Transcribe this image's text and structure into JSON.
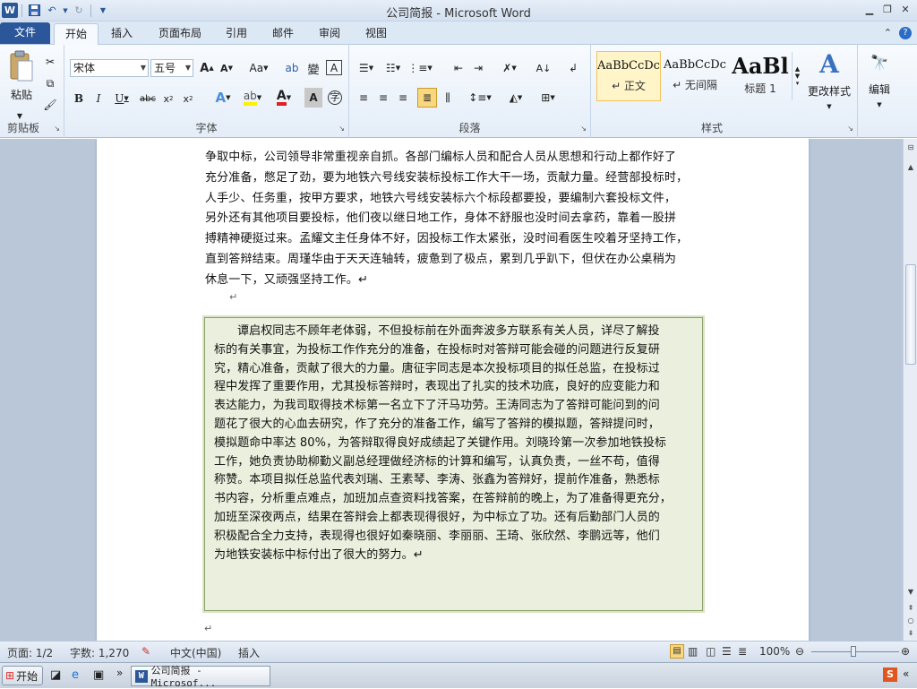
{
  "app": {
    "title": "公司简报 - Microsoft Word"
  },
  "tabs": [
    "文件",
    "开始",
    "插入",
    "页面布局",
    "引用",
    "邮件",
    "审阅",
    "视图"
  ],
  "ribbon": {
    "clipboard": {
      "paste": "粘贴",
      "label": "剪贴板"
    },
    "font": {
      "name": "宋体",
      "size": "五号",
      "label": "字体"
    },
    "paragraph": {
      "label": "段落"
    },
    "styles": {
      "label": "样式",
      "items": [
        {
          "sample": "AaBbCcDc",
          "name": "↵ 正文"
        },
        {
          "sample": "AaBbCcDc",
          "name": "↵ 无间隔"
        },
        {
          "sample": "AaBl",
          "name": "标题 1"
        }
      ],
      "change_styles": "更改样式"
    },
    "editing": {
      "label": "编辑"
    }
  },
  "document": {
    "para1_lines": [
      "争取中标，公司领导非常重视亲自抓。各部门编标人员和配合人员从思想和行动上都作好了",
      "充分准备，憋足了劲，要为地铁六号线安装标投标工作大干一场，贡献力量。经营部投标时，",
      "人手少、任务重，按甲方要求，地铁六号线安装标六个标段都要投，要编制六套投标文件，",
      "另外还有其他项目要投标，他们夜以继日地工作，身体不舒服也没时间去拿药，靠着一股拼",
      "搏精神硬挺过来。孟耀文主任身体不好，因投标工作太紧张，没时间看医生咬着牙坚持工作，",
      "直到答辩结束。周瑾华由于天天连轴转，疲惫到了极点，累到几乎趴下，但伏在办公桌稍为",
      "休息一下，又顽强坚持工作。↵"
    ],
    "empty_para_mark": "↵",
    "textbox_lines": [
      "谭启权同志不顾年老体弱，不但投标前在外面奔波多方联系有关人员，详尽了解投",
      "标的有关事宜，为投标工作作充分的准备，在投标时对答辩可能会碰的问题进行反复研",
      "究，精心准备，贡献了很大的力量。唐征宇同志是本次投标项目的拟任总监，在投标过",
      "程中发挥了重要作用，尤其投标答辩时，表现出了扎实的技术功底，良好的应变能力和",
      "表达能力，为我司取得技术标第一名立下了汗马功劳。王涛同志为了答辩可能问到的问",
      "题花了很大的心血去研究，作了充分的准备工作，编写了答辩的模拟题，答辩提问时，",
      "模拟题命中率达 80%，为答辩取得良好成绩起了关键作用。刘晓玲第一次参加地铁投标",
      "工作，她负责协助柳勤义副总经理做经济标的计算和编写，认真负责，一丝不苟，值得",
      "称赞。本项目拟任总监代表刘瑞、王素琴、李涛、张鑫为答辩好，提前作准备，熟悉标",
      "书内容，分析重点难点，加班加点查资料找答案，在答辩前的晚上，为了准备得更充分，",
      "加班至深夜两点，结果在答辩会上都表现得很好，为中标立了功。还有后勤部门人员的",
      "积极配合全力支持，表现得也很好如秦晓丽、李丽丽、王琦、张欣然、李鹏远等，他们",
      "为地铁安装标中标付出了很大的努力。↵"
    ]
  },
  "status": {
    "page": "页面: 1/2",
    "words": "字数: 1,270",
    "lang": "中文(中国)",
    "mode": "插入",
    "zoom": "100%"
  },
  "taskbar": {
    "start": "开始",
    "task": "公司简报 - Microsof..."
  }
}
